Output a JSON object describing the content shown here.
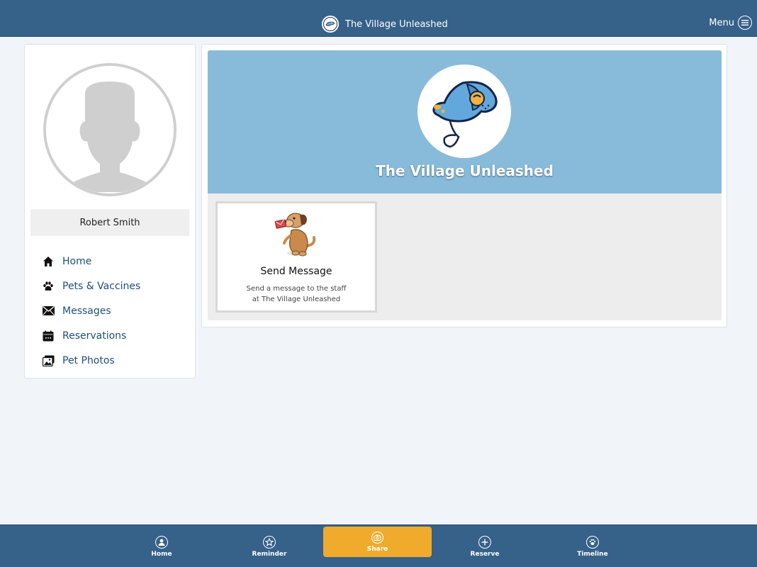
{
  "header": {
    "title": "The Village Unleashed",
    "menu_label": "Menu",
    "logo_icon": "dog-logo-icon",
    "menu_icon": "hamburger-circle-icon"
  },
  "profile": {
    "name": "Robert Smith",
    "avatar_icon": "person-silhouette-icon"
  },
  "nav": {
    "items": [
      {
        "label": "Home",
        "icon": "house-icon"
      },
      {
        "label": "Pets & Vaccines",
        "icon": "paw-icon"
      },
      {
        "label": "Messages",
        "icon": "envelope-icon"
      },
      {
        "label": "Reservations",
        "icon": "calendar-icon"
      },
      {
        "label": "Pet Photos",
        "icon": "photos-icon"
      }
    ]
  },
  "hero": {
    "title": "The Village Unleashed"
  },
  "tiles": [
    {
      "title": "Send Message",
      "desc_line1": "Send a message to the staff",
      "desc_line2": "at The Village Unleashed",
      "icon": "dog-with-letter-icon"
    }
  ],
  "bottom_nav": {
    "items": [
      {
        "label": "Home",
        "icon": "user-circle-icon"
      },
      {
        "label": "Reminder",
        "icon": "star-circle-icon"
      },
      {
        "label": "Share",
        "icon": "camera-circle-icon",
        "active": true
      },
      {
        "label": "Reserve",
        "icon": "plus-circle-icon"
      },
      {
        "label": "Timeline",
        "icon": "paw-circle-icon"
      }
    ]
  },
  "colors": {
    "header_bg": "#366189",
    "hero_bg": "#88bbda",
    "nav_link": "#1f4d7c",
    "active_tab": "#f0ab2d"
  }
}
